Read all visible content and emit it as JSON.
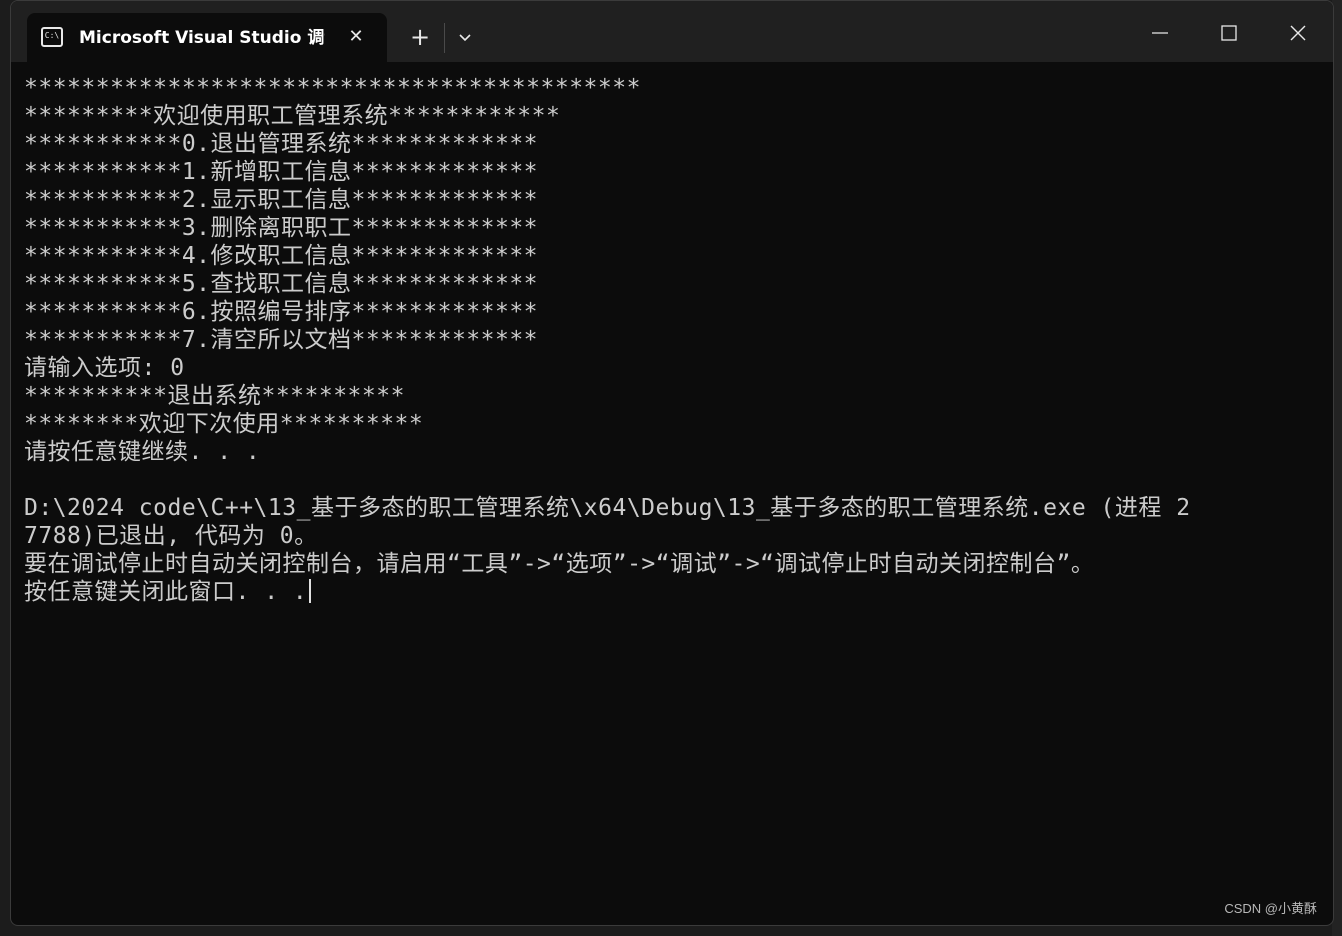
{
  "window": {
    "tab_title": "Microsoft Visual Studio 调试控制台",
    "tab_icon": "console-icon",
    "close_tab_glyph": "✕",
    "new_tab_glyph": "+",
    "accent_bg": "#0c0c0c",
    "titlebar_bg": "#202020"
  },
  "console": {
    "lines": [
      "*******************************************",
      "*********欢迎使用职工管理系统************",
      "***********0.退出管理系统*************",
      "***********1.新增职工信息*************",
      "***********2.显示职工信息*************",
      "***********3.删除离职职工*************",
      "***********4.修改职工信息*************",
      "***********5.查找职工信息*************",
      "***********6.按照编号排序*************",
      "***********7.清空所以文档*************",
      "请输入选项: 0",
      "**********退出系统**********",
      "********欢迎下次使用**********",
      "请按任意键继续. . .",
      "",
      "D:\\2024 code\\C++\\13_基于多态的职工管理系统\\x64\\Debug\\13_基于多态的职工管理系统.exe (进程 2",
      "7788)已退出, 代码为 0。",
      "要在调试停止时自动关闭控制台，请启用“工具”->“选项”->“调试”->“调试停止时自动关闭控制台”。",
      "按任意键关闭此窗口. . ."
    ],
    "text_color": "#cccccc"
  },
  "watermark": "CSDN @小黄酥"
}
